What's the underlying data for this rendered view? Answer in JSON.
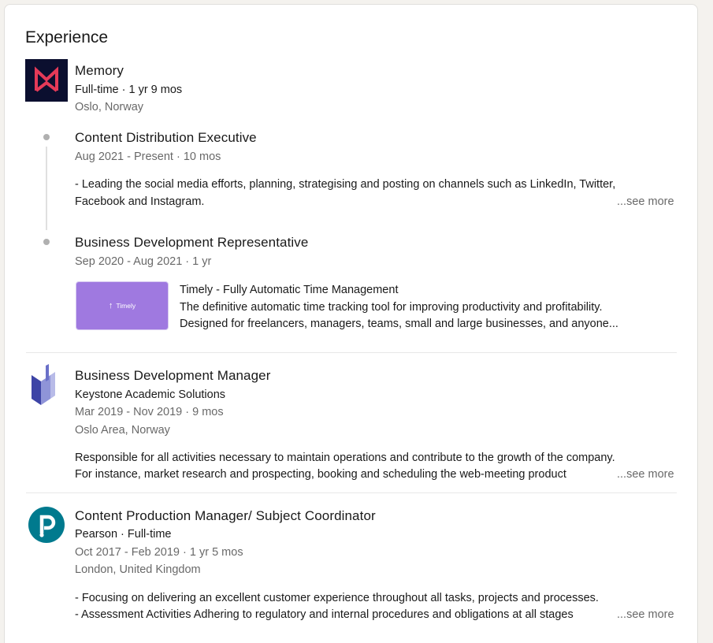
{
  "section_title": "Experience",
  "memory": {
    "company": "Memory",
    "meta": "Full-time · 1 yr 9 mos",
    "location": "Oslo, Norway",
    "brand_color": "#0b0f2f",
    "accent_color": "#e53a58",
    "roles": [
      {
        "title": "Content Distribution Executive",
        "dates": "Aug 2021 - Present · 10 mos",
        "desc_line1": "- Leading the social media efforts, planning, strategising and posting on channels such as LinkedIn, Twitter,",
        "desc_line2": "Facebook and Instagram.",
        "see_more": "...see more"
      },
      {
        "title": "Business Development Representative",
        "dates": "Sep 2020 - Aug 2021 · 1 yr",
        "media": {
          "thumb_label": "Timely",
          "title": "Timely - Fully Automatic Time Management",
          "desc_line1": "The definitive automatic time tracking tool for improving productivity and profitability.",
          "desc_line2": "Designed for freelancers, managers, teams, small and large businesses, and anyone..."
        }
      }
    ]
  },
  "keystone": {
    "title": "Business Development Manager",
    "company": "Keystone Academic Solutions",
    "dates": "Mar 2019 - Nov 2019 · 9 mos",
    "location": "Oslo Area, Norway",
    "desc_line1": "Responsible for all activities necessary to maintain operations and contribute to the growth of the company.",
    "desc_line2": "For instance, market research and prospecting, booking and scheduling the web-meeting product",
    "see_more": "...see more"
  },
  "pearson": {
    "title": "Content Production Manager/ Subject Coordinator",
    "company": "Pearson · Full-time",
    "dates": "Oct 2017 - Feb 2019 · 1 yr 5 mos",
    "location": "London, United Kingdom",
    "desc_line1": "- Focusing on delivering an excellent customer experience throughout all tasks, projects and processes.",
    "desc_line2": "- Assessment Activities Adhering to regulatory and internal procedures and obligations at all stages",
    "see_more": "...see more",
    "brand_color": "#007a8e"
  }
}
